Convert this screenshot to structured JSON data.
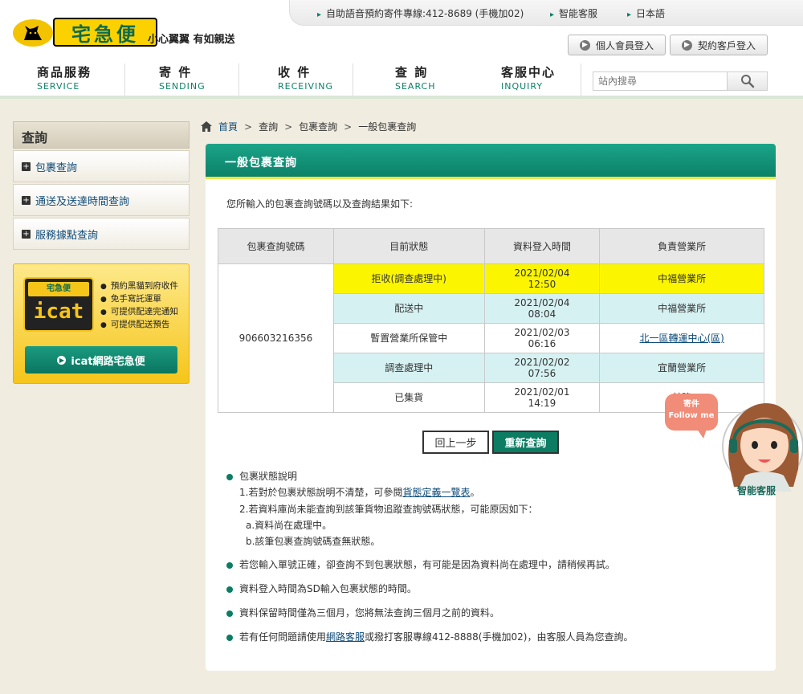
{
  "header": {
    "topbar": {
      "hotline": "自助語音預約寄件專線:412-8689 (手機加02)",
      "smart_service": "智能客服",
      "japanese": "日本語"
    },
    "logo_text": "宅急便",
    "slogan": "小心翼翼 有如親送",
    "login": {
      "member": "個人會員登入",
      "contract": "契約客戶登入"
    },
    "nav": [
      {
        "zh": "商品服務",
        "en": "SERVICE"
      },
      {
        "zh": "寄 件",
        "en": "SENDING"
      },
      {
        "zh": "收 件",
        "en": "RECEIVING"
      },
      {
        "zh": "查 詢",
        "en": "SEARCH"
      },
      {
        "zh": "客服中心",
        "en": "INQUIRY"
      }
    ],
    "search_placeholder": "站內搜尋"
  },
  "sidebar": {
    "title": "查詢",
    "items": [
      {
        "label": "包裹查詢"
      },
      {
        "label": "通送及送達時間查詢"
      },
      {
        "label": "服務據點查詢"
      }
    ],
    "icat": {
      "badge": "宅急便",
      "logo": "icat",
      "features": [
        "預約黑貓到府收件",
        "免手寫託運單",
        "可提供配達完通知",
        "可提供配送預告"
      ],
      "button": "icat網路宅急便"
    }
  },
  "breadcrumb": {
    "items": [
      "首頁",
      "查詢",
      "包裹查詢",
      "一般包裹查詢"
    ]
  },
  "main": {
    "title": "一般包裹查詢",
    "intro": "您所輸入的包裹查詢號碼以及查詢結果如下:",
    "table": {
      "headers": [
        "包裹查詢號碼",
        "目前狀態",
        "資料登入時間",
        "負責營業所"
      ],
      "tracking_number": "906603216356",
      "rows": [
        {
          "status": "拒收(調查處理中)",
          "date": "2021/02/04",
          "time": "12:50",
          "office": "中福營業所"
        },
        {
          "status": "配送中",
          "date": "2021/02/04",
          "time": "08:04",
          "office": "中福營業所"
        },
        {
          "status": "暫置營業所保管中",
          "date": "2021/02/03",
          "time": "06:16",
          "office": "北一區轉運中心(區)"
        },
        {
          "status": "調查處理中",
          "date": "2021/02/02",
          "time": "07:56",
          "office": "宜蘭營業所"
        },
        {
          "status": "已集貨",
          "date": "2021/02/01",
          "time": "14:19",
          "office": "基隆"
        }
      ]
    },
    "buttons": {
      "back": "回上一步",
      "requery": "重新查詢"
    },
    "notes": {
      "n1_title": "包裹狀態說明",
      "n1_l1a": "1.若對於包裹狀態說明不清楚，可參閱",
      "n1_l1_link": "貨態定義一覽表",
      "n1_l1b": "。",
      "n1_l2": "2.若資料庫尚未能查詢到該筆貨物追蹤查詢號碼狀態，可能原因如下：",
      "n1_l3": "a.資料尚在處理中。",
      "n1_l4": "b.該筆包裹查詢號碼查無狀態。",
      "n2": "若您輸入單號正確，卻查詢不到包裹狀態，有可能是因為資料尚在處理中，請稍候再試。",
      "n3": "資料登入時間為SD輸入包裹狀態的時間。",
      "n4": "資料保留時間僅為三個月，您將無法查詢三個月之前的資料。",
      "n5a": "若有任何問題請使用",
      "n5_link": "網路客服",
      "n5b": "或撥打客服專線412-8888(手機加02)，由客服人員為您查詢。"
    }
  },
  "assistant": {
    "bubble_line1": "寄件",
    "bubble_line2": "Follow me",
    "label": "智能客服"
  },
  "colors": {
    "brand_green": "#0c8168",
    "highlight_yellow": "#fbf500",
    "row_cyan": "#d6f1f2",
    "logo_yellow": "#fbd200"
  }
}
